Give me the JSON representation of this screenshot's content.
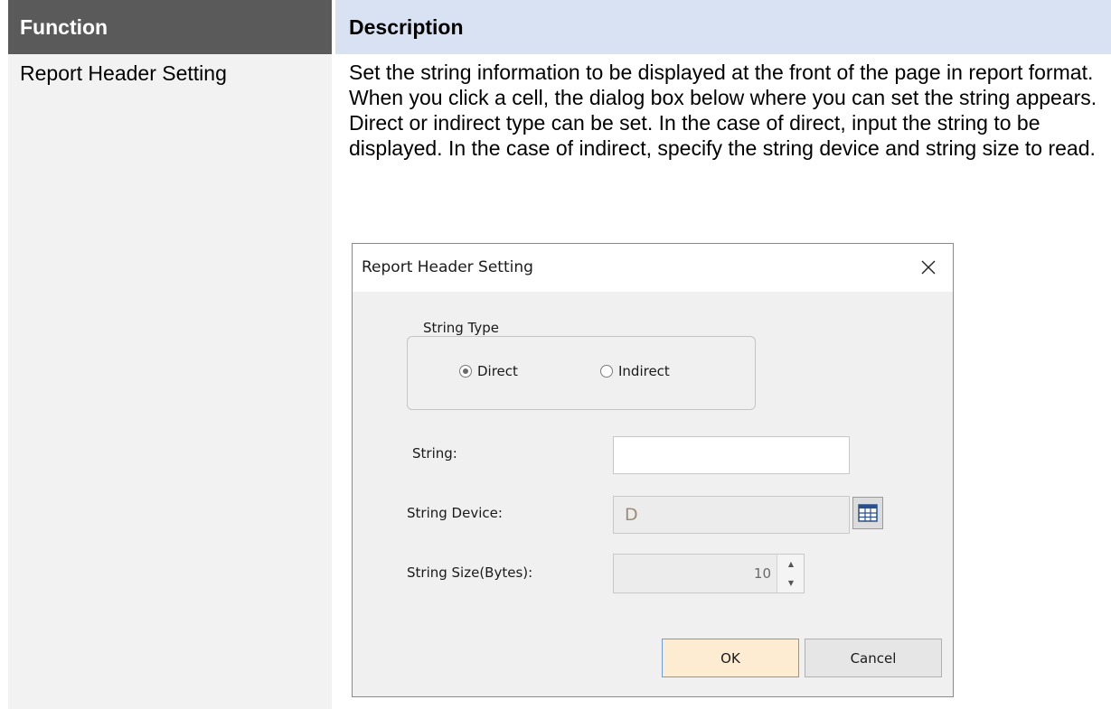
{
  "table": {
    "headers": {
      "function": "Function",
      "description": "Description"
    },
    "row": {
      "function": "Report Header Setting",
      "description": "Set the string information to be displayed at the front of the page in report format. When you click a cell, the dialog box below where you can set the string appears. Direct or indirect type can be set. In the case of direct, input the string to be displayed. In the case of indirect, specify the string device and string size to read."
    }
  },
  "colors": {
    "header_function_bg": "#5a5a5a",
    "header_description_bg": "#d9e2f3",
    "function_cell_bg": "#f2f2f2",
    "ok_button_bg": "#fdecd2"
  },
  "dialog": {
    "title": "Report Header Setting",
    "close_icon": "close-icon",
    "string_type": {
      "legend": "String Type",
      "options": [
        "Direct",
        "Indirect"
      ],
      "selected": "Direct"
    },
    "string": {
      "label": "String:",
      "value": ""
    },
    "string_device": {
      "label": "String Device:",
      "value": "D",
      "browse_icon": "device-browse-icon"
    },
    "string_size": {
      "label": "String Size(Bytes):",
      "value": "10"
    },
    "buttons": {
      "ok": "OK",
      "cancel": "Cancel"
    }
  }
}
